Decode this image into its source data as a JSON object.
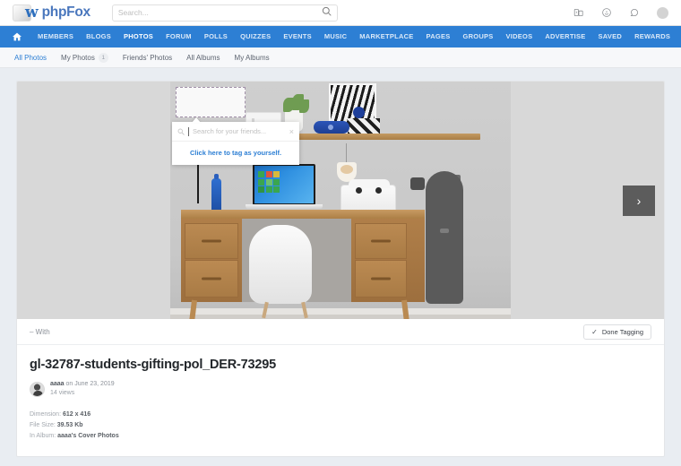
{
  "header": {
    "logo_text": "phpFox",
    "search_placeholder": "Search...",
    "icons": {
      "search": "search-icon",
      "friends": "friends-icon",
      "messages": "messages-icon",
      "notifications": "notifications-icon"
    }
  },
  "mainnav": {
    "home_label": "Home",
    "items": [
      {
        "label": "MEMBERS",
        "active": false
      },
      {
        "label": "BLOGS",
        "active": false
      },
      {
        "label": "PHOTOS",
        "active": true
      },
      {
        "label": "FORUM",
        "active": false
      },
      {
        "label": "POLLS",
        "active": false
      },
      {
        "label": "QUIZZES",
        "active": false
      },
      {
        "label": "EVENTS",
        "active": false
      },
      {
        "label": "MUSIC",
        "active": false
      },
      {
        "label": "MARKETPLACE",
        "active": false
      },
      {
        "label": "PAGES",
        "active": false
      },
      {
        "label": "GROUPS",
        "active": false
      },
      {
        "label": "VIDEOS",
        "active": false
      },
      {
        "label": "ADVERTISE",
        "active": false
      },
      {
        "label": "SAVED",
        "active": false
      },
      {
        "label": "REWARDS",
        "active": false
      }
    ]
  },
  "subnav": {
    "items": [
      {
        "label": "All Photos",
        "badge": "",
        "active": true
      },
      {
        "label": "My Photos",
        "badge": "1",
        "active": false
      },
      {
        "label": "Friends' Photos",
        "badge": "",
        "active": false
      },
      {
        "label": "All Albums",
        "badge": "",
        "active": false
      },
      {
        "label": "My Albums",
        "badge": "",
        "active": false
      }
    ]
  },
  "viewer": {
    "next_arrow": "›",
    "tag_popup": {
      "search_placeholder": "Search for your friends...",
      "close_label": "×",
      "tag_self_label": "Click here to tag as yourself."
    }
  },
  "with_bar": {
    "with_label": "– With",
    "done_label": "Done Tagging",
    "check_glyph": "✓"
  },
  "photo_info": {
    "title": "gl-32787-students-gifting-pol_DER-73295",
    "author": "aaaa",
    "posted_on": "on June 23, 2019",
    "views": "14 views",
    "dimension_label": "Dimension:",
    "dimension_value": "612 x 416",
    "filesize_label": "File Size:",
    "filesize_value": "39.53 Kb",
    "album_label": "In Album:",
    "album_value": "aaaa's Cover Photos"
  },
  "colors": {
    "nav_blue": "#2d7fd4",
    "page_bg": "#e9edf2",
    "viewer_bg": "#d8d8d8",
    "link_blue": "#2d7fd4"
  }
}
